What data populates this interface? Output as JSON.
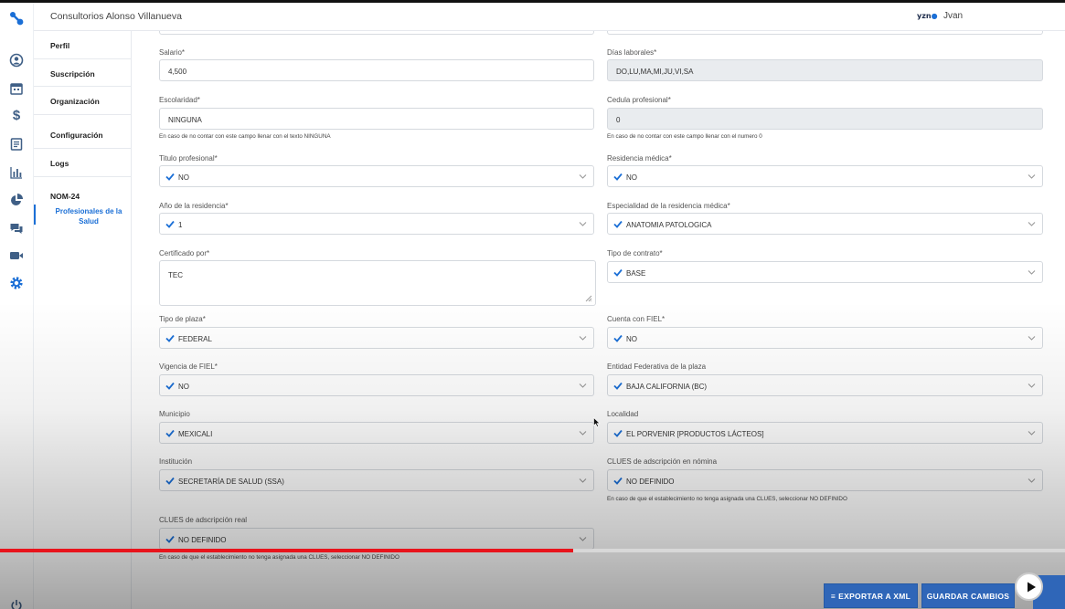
{
  "app": {
    "title": "Consultorios Alonso Villanueva",
    "user_logo": "yzn",
    "user_name": "Jvan"
  },
  "rail": {
    "icons": [
      "logo-icon",
      "user-circle-icon",
      "calendar-icon",
      "dollar-icon",
      "document-icon",
      "bar-chart-icon",
      "chart-pie-icon",
      "chat-icon",
      "video-icon",
      "gear-icon",
      "power-icon"
    ]
  },
  "sidenav": {
    "items": [
      {
        "label": "Perfil"
      },
      {
        "label": "Suscripción"
      },
      {
        "label": "Organización"
      },
      {
        "label": "Configuración"
      },
      {
        "label": "Logs"
      },
      {
        "label": "NOM-24"
      }
    ],
    "subitem": "Profesionales de la Salud"
  },
  "form": {
    "salario": {
      "label": "Salario*",
      "value": "4,500"
    },
    "dias_laborales": {
      "label": "Días laborales*",
      "value": "DO,LU,MA,MI,JU,VI,SA"
    },
    "escolaridad": {
      "label": "Escolaridad*",
      "value": "NINGUNA",
      "hint": "En caso de no contar con este campo llenar con el texto NINGUNA"
    },
    "cedula": {
      "label": "Cedula profesional*",
      "value": "0",
      "hint": "En caso de no contar con este campo llenar con el numero 0"
    },
    "titulo": {
      "label": "Titulo profesional*",
      "value": "NO"
    },
    "residencia_medica": {
      "label": "Residencia médica*",
      "value": "NO"
    },
    "anio_residencia": {
      "label": "Año de la residencia*",
      "value": "1"
    },
    "especialidad": {
      "label": "Especialidad de la residencia médica*",
      "value": "ANATOMIA PATOLOGICA"
    },
    "certificado": {
      "label": "Certificado por*",
      "value": "TEC"
    },
    "tipo_contrato": {
      "label": "Tipo de contrato*",
      "value": "BASE"
    },
    "tipo_plaza": {
      "label": "Tipo de plaza*",
      "value": "FEDERAL"
    },
    "cuenta_fiel": {
      "label": "Cuenta con FIEL*",
      "value": "NO"
    },
    "vigencia_fiel": {
      "label": "Vigencia de FIEL*",
      "value": "NO"
    },
    "entidad": {
      "label": "Entidad Federativa de la plaza",
      "value": "BAJA CALIFORNIA (BC)"
    },
    "municipio": {
      "label": "Municipio",
      "value": "MEXICALI"
    },
    "localidad": {
      "label": "Localidad",
      "value": "EL PORVENIR [PRODUCTOS LÁCTEOS]"
    },
    "institucion": {
      "label": "Institución",
      "value": "SECRETARÍA DE SALUD (SSA)"
    },
    "clues_nomina": {
      "label": "CLUES de adscripción en nómina",
      "value": "NO DEFINIDO",
      "hint": "En caso de que el establecimiento no tenga asignada una CLUES, seleccionar NO DEFINIDO"
    },
    "clues_real": {
      "label": "CLUES de adscripción real",
      "value": "NO DEFINIDO",
      "hint": "En caso de que el establecimiento no tenga asignada una CLUES, seleccionar NO DEFINIDO"
    }
  },
  "actions": {
    "export_label": "EXPORTAR A XML",
    "save_label": "GUARDAR CAMBIOS"
  },
  "video": {
    "progress": 0.538
  },
  "colors": {
    "accent": "#1b6fd6",
    "button": "#2f66b8",
    "progress": "#e8141c"
  }
}
